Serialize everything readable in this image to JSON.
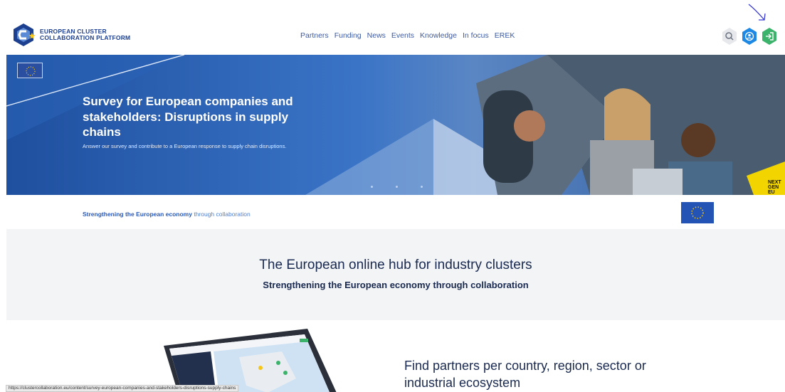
{
  "header": {
    "logo_line1": "EUROPEAN CLUSTER",
    "logo_line2": "COLLABORATION PLATFORM",
    "nav": [
      "Partners",
      "Funding",
      "News",
      "Events",
      "Knowledge",
      "In focus",
      "EREK"
    ],
    "icons": [
      "search-icon",
      "user-icon",
      "login-icon"
    ]
  },
  "hero": {
    "title": "Survey for European companies and stakeholders: Disruptions in supply chains",
    "subtitle": "Answer our survey and contribute to a European response to supply chain disruptions.",
    "badge": "NEXT GEN EU"
  },
  "strip": {
    "highlight": "Strengthening the European economy",
    "rest": " through collaboration"
  },
  "hub": {
    "title": "The European online hub for industry clusters",
    "subtitle": "Strengthening the European economy through collaboration"
  },
  "partners": {
    "title": "Find partners per country, region, sector or industrial ecosystem"
  },
  "status_url": "https://clustercollaboration.eu/content/survey-european-companies-and-stakeholders-disruptions-supply-chains",
  "colors": {
    "brand_blue": "#1d3f8f",
    "hero_blue": "#2b5fb0",
    "green": "#3bb36b",
    "hub_bg": "#f2f4f6"
  }
}
